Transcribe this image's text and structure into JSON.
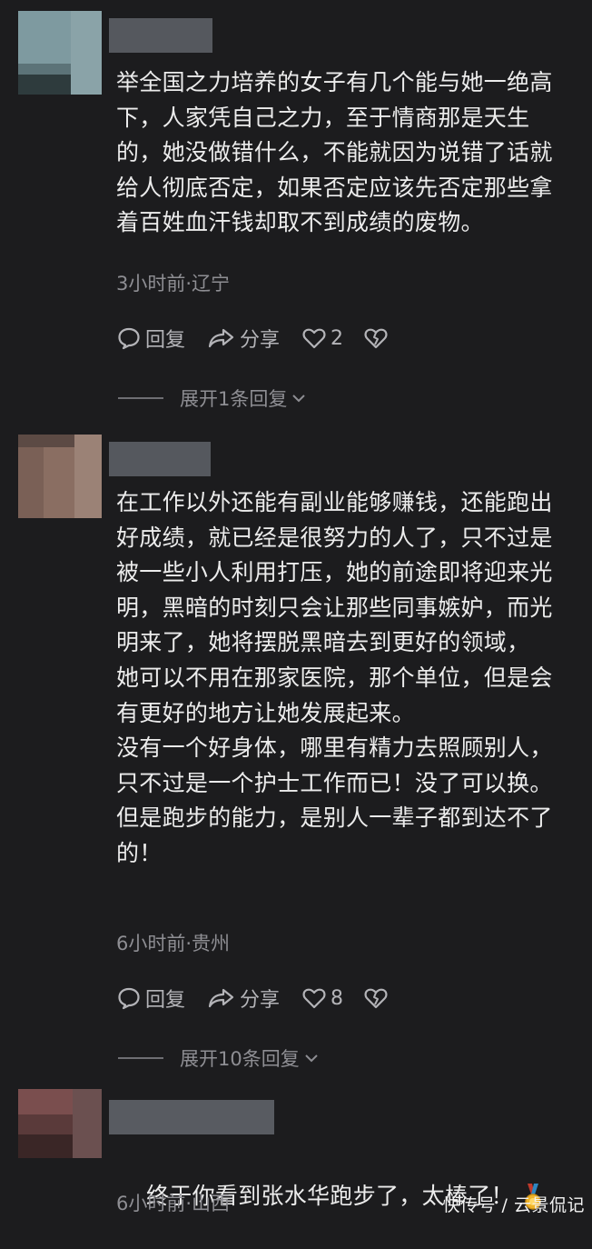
{
  "comments": [
    {
      "text": "举全国之力培养的女子有几个能与她一绝高\n下，人家凭自己之力，至于情商那是天生\n的，她没做错什么，不能就因为说错了话就\n给人彻底否定，如果否定应该先否定那些拿\n着百姓血汗钱却取不到成绩的废物。",
      "meta": "3小时前·辽宁",
      "reply_label": "回复",
      "share_label": "分享",
      "likes": "2",
      "expand_label": "展开1条回复"
    },
    {
      "text": "在工作以外还能有副业能够赚钱，还能跑出\n好成绩，就已经是很努力的人了，只不过是\n被一些小人利用打压，她的前途即将迎来光\n明，黑暗的时刻只会让那些同事嫉妒，而光\n明来了，她将摆脱黑暗去到更好的领域，\n她可以不用在那家医院，那个单位，但是会\n有更好的地方让她发展起来。\n没有一个好身体，哪里有精力去照顾别人，\n只不过是一个护士工作而已！没了可以换。\n但是跑步的能力，是别人一辈子都到达不了\n的！",
      "meta": "6小时前·贵州",
      "reply_label": "回复",
      "share_label": "分享",
      "likes": "8",
      "expand_label": "展开10条回复"
    },
    {
      "text": "终于你看到张水华跑步了，太棒了！",
      "meta": "6小时前·山西"
    }
  ],
  "watermark": "快传号 / 云景侃记",
  "icons": {
    "reply": "comment-bubble-icon",
    "share": "share-arrow-icon",
    "like": "heart-icon",
    "dislike": "broken-heart-icon",
    "expand": "chevron-down-icon",
    "medal": "medal-emoji-icon"
  },
  "colors": {
    "background": "#1c1c1e",
    "text": "#ececec",
    "meta": "#8e8e93"
  }
}
